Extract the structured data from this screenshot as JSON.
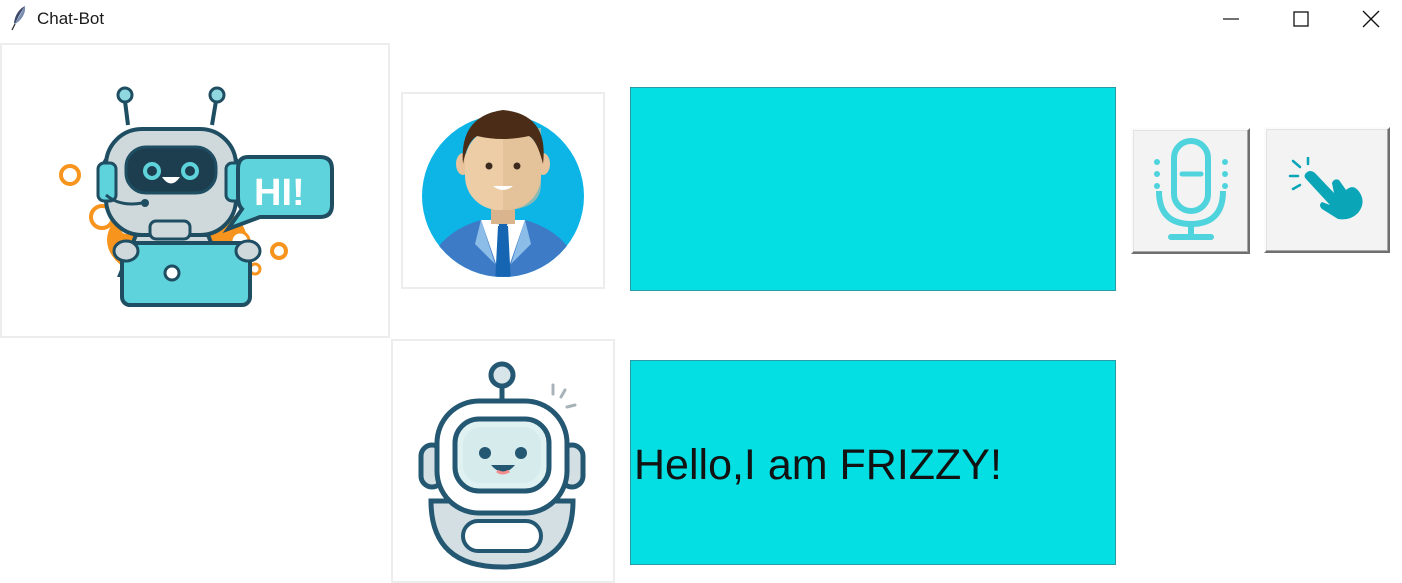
{
  "window": {
    "title": "Chat-Bot",
    "app_icon": "feather-icon",
    "controls": {
      "minimize": "minimize-icon",
      "maximize": "maximize-icon",
      "close": "close-icon"
    }
  },
  "images": {
    "bot_main": "robot-with-laptop-hi-icon",
    "hi_bubble_text": "HI!",
    "user_avatar": "businessman-avatar-icon",
    "bot_avatar": "smiling-robot-icon"
  },
  "conversation": {
    "user_message": "",
    "bot_message": "Hello,I am FRIZZY!"
  },
  "buttons": {
    "mic": "microphone-icon",
    "tap": "tap-hand-icon"
  },
  "colors": {
    "message_bg": "#03dfe3",
    "accent_orange": "#f7941d",
    "accent_teal": "#53d5dd"
  }
}
